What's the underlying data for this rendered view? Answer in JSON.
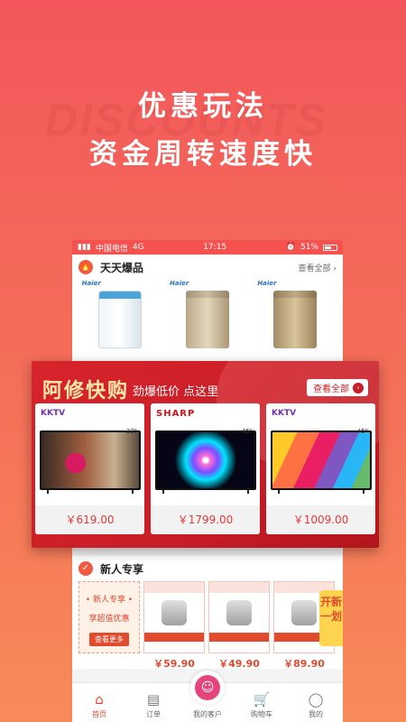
{
  "hero": {
    "watermark": "DISCOUNTS",
    "line1": "优惠玩法",
    "line2": "资金周转速度快"
  },
  "status": {
    "carrier": "中国电信",
    "network": "4G",
    "time": "17:15",
    "battery": "51%"
  },
  "hot": {
    "title": "天天爆品",
    "more": "查看全部",
    "icon": "fire-icon",
    "items": [
      {
        "brand": "Haier"
      },
      {
        "brand": "Haier"
      },
      {
        "brand": "Haier"
      }
    ]
  },
  "promo": {
    "title": "阿修快购",
    "subtitle": "劲爆低价 点这里",
    "more": "查看全部",
    "items": [
      {
        "brand": "KKTV",
        "price": "￥619.00",
        "size": "32\""
      },
      {
        "brand": "SHARP",
        "price": "￥1799.00",
        "size": "45\""
      },
      {
        "brand": "KKTV",
        "price": "￥1009.00",
        "size": "45\""
      }
    ]
  },
  "newuser": {
    "title": "新人专享",
    "left_title": "• 新人专享 •",
    "left_sub": "享超值优惠",
    "left_btn": "查看更多",
    "prices": [
      "￥59.90",
      "￥49.90",
      "￥89.90"
    ],
    "tag": "开新一划"
  },
  "tabs": [
    {
      "label": "首页",
      "icon": "home-icon"
    },
    {
      "label": "订单",
      "icon": "order-icon"
    },
    {
      "label": "我的客户",
      "icon": "customer-icon"
    },
    {
      "label": "购物车",
      "icon": "cart-icon"
    },
    {
      "label": "我的",
      "icon": "profile-icon"
    }
  ],
  "colors": {
    "accent": "#e24a2e",
    "promo_bg": "#c81d26",
    "price": "#e53935"
  }
}
